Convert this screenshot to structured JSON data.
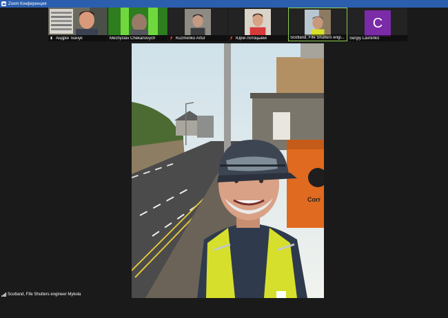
{
  "window": {
    "title": "Zoom Конференция"
  },
  "participants": [
    {
      "name": "Андрій Ткачук",
      "muted": false,
      "active": false
    },
    {
      "name": "Mechyslav Chekanovych",
      "muted": false,
      "active": false
    },
    {
      "name": "Kuzmenko Artur",
      "muted": true,
      "active": false
    },
    {
      "name": "Юрій Лотоцький",
      "muted": true,
      "active": false
    },
    {
      "name": "Scotland, Fife Shutters engi...",
      "muted": false,
      "active": true
    },
    {
      "name": "Sergiy Lavrenko",
      "muted": false,
      "active": false,
      "avatar_letter": "C",
      "avatar_color": "#7b2ba8"
    }
  ],
  "main_video": {
    "speaker_name": "Scotland, Fife Shutters engineer Mykola",
    "sign_text": "Corr"
  },
  "colors": {
    "active_border": "#8fd14f",
    "muted_icon": "#e0443c",
    "titlebar": "#2b5fae"
  }
}
